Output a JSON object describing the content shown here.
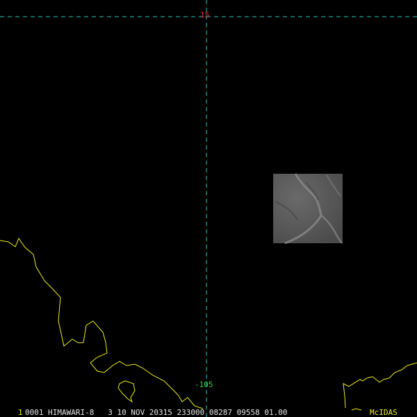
{
  "map": {
    "grid_latitude_label": "15",
    "grid_longitude_label": "-105",
    "grid_color": "#30c8c8",
    "coastline_color": "#f0f020",
    "background_color": "#000000"
  },
  "imagery": {
    "satellite": "HIMAWARI-8",
    "kind": "grayscale satellite image patch"
  },
  "status_bar": {
    "frame_number": "1",
    "image_info": "0001 HIMAWARI-8   3 10 NOV 20315 233000 08287 09558 01.00",
    "logo": "McIDAS"
  }
}
